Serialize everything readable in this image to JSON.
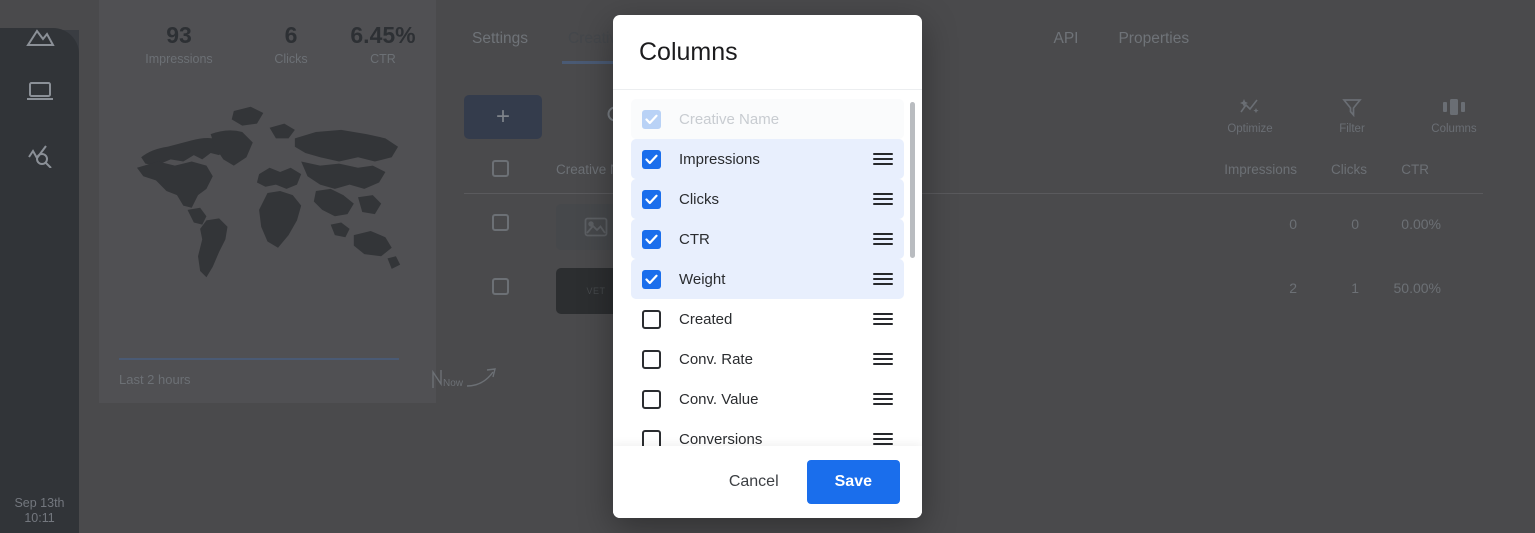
{
  "sidebar": {
    "icons": [
      {
        "name": "image-icon"
      },
      {
        "name": "monitor-icon"
      },
      {
        "name": "analytics-search-icon"
      }
    ],
    "clock": {
      "date": "Sep 13th",
      "time": "10:11"
    }
  },
  "stats_panel": {
    "kpis": [
      {
        "value": "93",
        "label": "Impressions"
      },
      {
        "value": "6",
        "label": "Clicks"
      },
      {
        "value": "6.45%",
        "label": "CTR"
      }
    ],
    "map_icon": "world-map",
    "range_label": "Last 2 hours",
    "now_label": "Now"
  },
  "main": {
    "tabs": [
      {
        "label": "Settings",
        "active": false
      },
      {
        "label": "Creatives",
        "active": true
      },
      {
        "label": "API",
        "active": false
      },
      {
        "label": "Properties",
        "active": false
      }
    ],
    "add_button_label": "+",
    "search_icon": "search-icon",
    "tools": [
      {
        "label": "Optimize",
        "icon": "sparkle-icon"
      },
      {
        "label": "Filter",
        "icon": "funnel-icon"
      },
      {
        "label": "Columns",
        "icon": "columns-icon"
      }
    ],
    "table": {
      "headers": [
        "Creative Name",
        "Impressions",
        "Clicks",
        "CTR"
      ],
      "rows": [
        {
          "thumb": "image-placeholder",
          "thumb_text": "",
          "impressions": "0",
          "clicks": "0",
          "ctr": "0.00%"
        },
        {
          "thumb": "dark-banner",
          "thumb_text": "VET",
          "impressions": "2",
          "clicks": "1",
          "ctr": "50.00%"
        }
      ]
    }
  },
  "modal": {
    "title": "Columns",
    "options": [
      {
        "label": "Creative Name",
        "checked": true,
        "disabled": true
      },
      {
        "label": "Impressions",
        "checked": true,
        "disabled": false
      },
      {
        "label": "Clicks",
        "checked": true,
        "disabled": false
      },
      {
        "label": "CTR",
        "checked": true,
        "disabled": false
      },
      {
        "label": "Weight",
        "checked": true,
        "disabled": false
      },
      {
        "label": "Created",
        "checked": false,
        "disabled": false
      },
      {
        "label": "Conv. Rate",
        "checked": false,
        "disabled": false
      },
      {
        "label": "Conv. Value",
        "checked": false,
        "disabled": false
      },
      {
        "label": "Conversions",
        "checked": false,
        "disabled": false
      }
    ],
    "cancel_label": "Cancel",
    "save_label": "Save"
  },
  "colors": {
    "accent_blue": "#1a6eec",
    "row_selected": "#e8effd",
    "checkbox_ghost": "#b9d2f6",
    "app_bg": "#4a4a4c",
    "sidebar_bg": "#313438"
  }
}
